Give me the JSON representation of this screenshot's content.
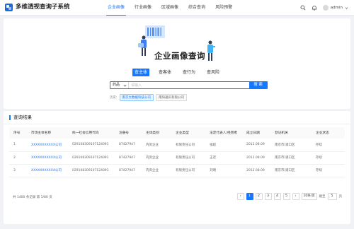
{
  "header": {
    "app_title": "多维透视查询子系统",
    "nav": [
      "企业画像",
      "行业画像",
      "区域画像",
      "综合查询",
      "风险预警"
    ],
    "active_nav": "企业画像",
    "user": "admin"
  },
  "hero": {
    "title": "企业画像查询",
    "tabs": [
      "查主体",
      "查客体",
      "查行为",
      "查风险"
    ],
    "active_tab": "查主体"
  },
  "search": {
    "select_value": "药品",
    "placeholder": "请输入",
    "button": "搜 索",
    "history_label": "历史:",
    "history_tags": [
      "南京大数据科技公司",
      "南阳通讯有限公司"
    ]
  },
  "results": {
    "title": "查询结果",
    "columns": [
      "序号",
      "市场主体名称",
      "统一社会信用代码",
      "注册号",
      "主体类别",
      "企业类型",
      "法定代表人/经营者",
      "成立日期",
      "登记机关",
      "企业状态"
    ],
    "rows": [
      [
        "1",
        "XXXXXXXXXXX公司",
        "029108309107124091",
        "87427947",
        "内资企业",
        "有限责任公司",
        "张超",
        "2012.08.09",
        "南京市/浦口区",
        "存续"
      ],
      [
        "2",
        "XXXXXXXXXXX公司",
        "029108309107124091",
        "87427947",
        "内资企业",
        "有限责任公司",
        "王迟",
        "2012.08.09",
        "南京市/浦口区",
        "存续"
      ],
      [
        "3",
        "XXXXXXXXXXX公司",
        "029108309107124091",
        "87427947",
        "内资企业",
        "有限责任公司",
        "刘明",
        "2012.08.09",
        "南京市/浦口区",
        "存续"
      ]
    ]
  },
  "pagination": {
    "summary": "共 1400 条记录 第 1/80 页",
    "prev": "‹",
    "next": "›",
    "pages": [
      "1",
      "2",
      "3",
      "4",
      "5"
    ],
    "current": "1",
    "page_size": "10条/页",
    "goto_label": "跳至",
    "goto_value": "5",
    "goto_suffix": "页"
  },
  "colors": {
    "accent": "#1677ff"
  }
}
